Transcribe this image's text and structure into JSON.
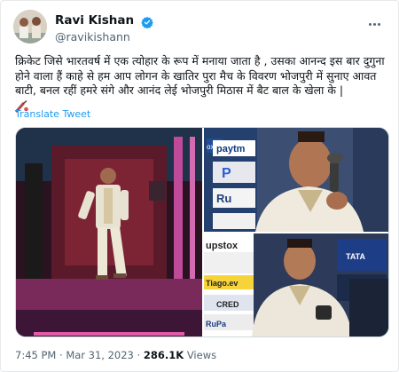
{
  "author": {
    "display_name": "Ravi Kishan",
    "handle": "@ravikishann",
    "verified_badge": "verified-badge-icon",
    "badge_color": "#1d9bf0"
  },
  "tweet": {
    "text": "क्रिकेट जिसे भारतवर्ष में एक त्योहार के रूप में मनाया जाता है , उसका आनन्द इस बार दुगुना होने वाला हैं काहे से हम आप लोगन के खातिर पुरा मैच के विवरण भोजपुरी में सुनाए आवत बाटी, बनल रहीं हमरे संगे और आनंद लेई भोजपुरी मिठास में बैट बाल के खेला के |",
    "emoji_icon": "cricket-bat-icon",
    "translate_label": "Translate Tweet"
  },
  "media": {
    "photos": [
      "stage-walk-photo",
      "commentary-closeup-photo",
      "commentary-wide-photo"
    ],
    "sponsor_texts": {
      "tl": "ox",
      "paytm": "paytm",
      "pay_letter": "P",
      "ru": "Ru",
      "upstox": "upstox",
      "tiago": "Tiago.ev",
      "tata": "TATA",
      "cred": "CRED",
      "rupay": "RuPa"
    }
  },
  "meta": {
    "time": "7:45 PM",
    "separator": "·",
    "date": "Mar 31, 2023",
    "views_count": "286.1K",
    "views_label": "Views"
  },
  "colors": {
    "link": "#1d9bf0",
    "secondary_text": "#536471",
    "primary_text": "#0f1419"
  }
}
